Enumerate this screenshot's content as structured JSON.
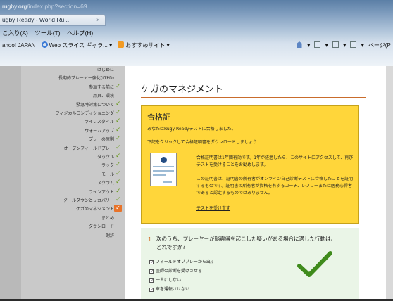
{
  "browser": {
    "url_domain": "rugby.org",
    "url_path": "/index.php?section=69",
    "tab_title": "ugby Ready - World Ru...",
    "tab_close": "×",
    "menu": [
      "こ入り(A)",
      "ツール(T)",
      "ヘルプ(H)"
    ],
    "favorites": [
      "ahoo! JAPAN",
      "Web スライス ギャラ...",
      "おすすめサイト"
    ],
    "page_menu": "ページ(P"
  },
  "nav": {
    "items": [
      {
        "label": "はじめに",
        "checked": false
      },
      {
        "label": "長期的プレーヤー強化(LTPD)",
        "checked": false
      },
      {
        "label": "参加する前に",
        "checked": true
      },
      {
        "label": "用具、環境",
        "checked": false
      },
      {
        "label": "緊急時対策について",
        "checked": true
      },
      {
        "label": "フィジカルコンディショニング",
        "checked": true
      },
      {
        "label": "ライフスタイル",
        "checked": true
      },
      {
        "label": "ウォームアップ",
        "checked": true
      },
      {
        "label": "プレーの原則",
        "checked": true
      },
      {
        "label": "オープンフィールドプレー",
        "checked": true
      },
      {
        "label": "タックル",
        "checked": true
      },
      {
        "label": "ラック",
        "checked": true
      },
      {
        "label": "モール",
        "checked": true
      },
      {
        "label": "スクラム",
        "checked": true
      },
      {
        "label": "ラインアウト",
        "checked": true
      },
      {
        "label": "クールダウンとリカバリー",
        "checked": true
      },
      {
        "label": "ケガのマネジメント",
        "checked": true,
        "active": true
      },
      {
        "label": "まとめ",
        "checked": false
      },
      {
        "label": "ダウンロード",
        "checked": false
      },
      {
        "label": "謝辞",
        "checked": false
      }
    ]
  },
  "main": {
    "heading": "ケガのマネジメント",
    "certificate": {
      "title": "合格証",
      "line1": "あなたはRugy Readyテストに合格しました。",
      "line2": "下記をクリックして合格証明書をダウンロードしましょう",
      "para1": "合格証明書は1年間有効です。1年が経過したら、このサイトにアクセスして、再びテストを受けることをお勧めします。",
      "para2": "この証明書は、証明書の所有者がオンライン自己診断テストに合格したことを証明するものです。証明書の所有者が資格を有するコーチ、レフリーまたは医務心得者であると認定するものではありません。",
      "retake_link": "テストを受け直す"
    },
    "quiz": {
      "number": "1.",
      "question": "次のうち、プレーヤーが脳震盪を起こした疑いがある場合に適した行動は、どれですか?",
      "options": [
        "フィールドオブプレーから出す",
        "医師の診断を受けさせる",
        "一人にしない",
        "車を運転させない"
      ]
    }
  },
  "colors": {
    "accent_orange": "#e8732a",
    "check_green": "#6a9a1f",
    "certificate_yellow": "#ffd63a",
    "quiz_bg": "#eaf5e7"
  }
}
